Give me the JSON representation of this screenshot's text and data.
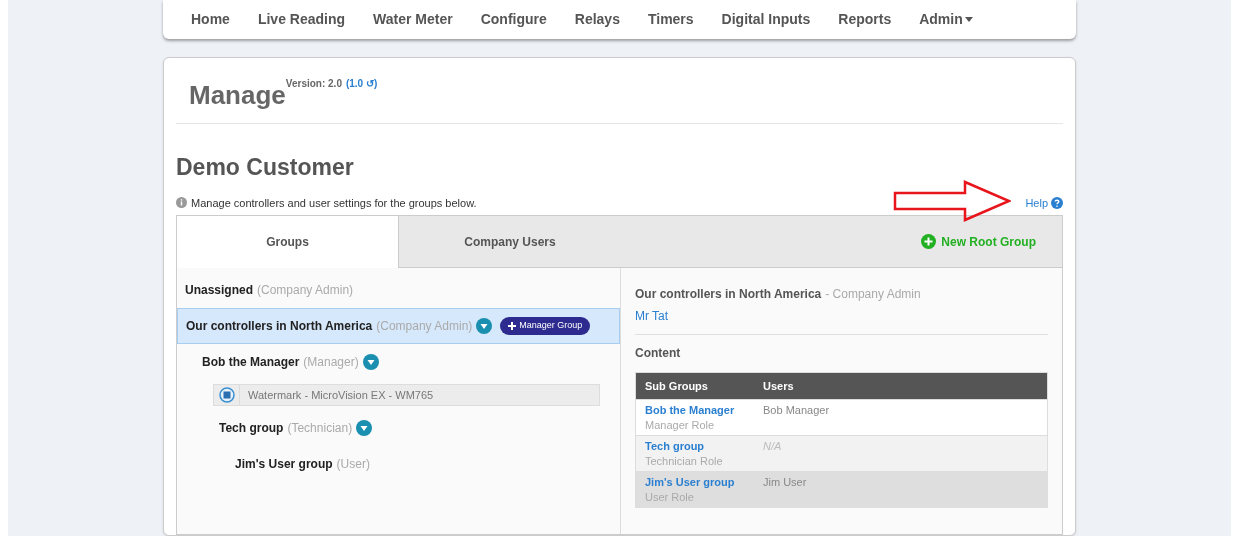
{
  "nav": [
    {
      "label": "Home",
      "dropdown": false
    },
    {
      "label": "Live Reading",
      "dropdown": false
    },
    {
      "label": "Water Meter",
      "dropdown": false
    },
    {
      "label": "Configure",
      "dropdown": false
    },
    {
      "label": "Relays",
      "dropdown": false
    },
    {
      "label": "Timers",
      "dropdown": false
    },
    {
      "label": "Digital Inputs",
      "dropdown": false
    },
    {
      "label": "Reports",
      "dropdown": false
    },
    {
      "label": "Admin",
      "dropdown": true
    }
  ],
  "page": {
    "title": "Manage",
    "version_label": "Version: 2.0",
    "version_link": "(1.0 ↺)"
  },
  "customer": {
    "title": "Demo Customer",
    "info": "Manage controllers and user settings for the groups below.",
    "help": "Help"
  },
  "tabs": [
    {
      "label": "Groups",
      "selected": true
    },
    {
      "label": "Company Users",
      "selected": false
    }
  ],
  "new_root_group": "New Root Group",
  "tree": [
    {
      "kind": "group",
      "name": "Unassigned",
      "role": "(Company Admin)",
      "selected": false,
      "menu": false
    },
    {
      "kind": "group",
      "name": "Our controllers in North America",
      "role": "(Company Admin)",
      "selected": true,
      "menu": true,
      "badge": "Manager Group",
      "children": [
        {
          "kind": "group",
          "name": "Bob the Manager",
          "role": "(Manager)",
          "selected": false,
          "menu": true,
          "children": [
            {
              "kind": "controller",
              "name": "Watermark - MicroVision EX - WM765"
            },
            {
              "kind": "group",
              "name": "Tech group",
              "role": "(Technician)",
              "selected": false,
              "menu": true,
              "children": [
                {
                  "kind": "group",
                  "name": "Jim's User group",
                  "role": "(User)",
                  "selected": false,
                  "menu": false
                }
              ]
            }
          ]
        }
      ]
    }
  ],
  "detail": {
    "name": "Our controllers in North America",
    "role": "- Company Admin",
    "owner": "Mr Tat",
    "content_title": "Content",
    "columns": [
      "Sub Groups",
      "Users"
    ],
    "rows": [
      {
        "group": "Bob the Manager",
        "role": "Manager Role",
        "users": "Bob Manager",
        "users_missing": false,
        "hovered": false
      },
      {
        "group": "Tech group",
        "role": "Technician Role",
        "users": "N/A",
        "users_missing": true,
        "hovered": false
      },
      {
        "group": "Jim's User group",
        "role": "User Role",
        "users": "Jim User",
        "users_missing": false,
        "hovered": true
      }
    ]
  }
}
